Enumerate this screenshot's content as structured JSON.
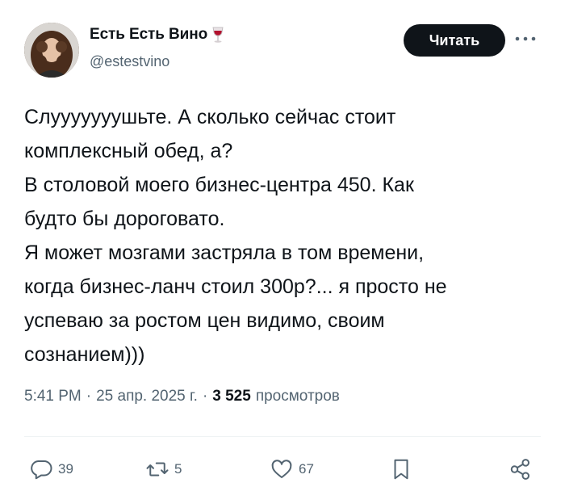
{
  "author": {
    "display_name": "Есть Есть Вино",
    "name_emoji": "wine-glass-icon",
    "handle": "@estestvino",
    "avatar": "avatar"
  },
  "follow_label": "Читать",
  "more_icon": "more-icon",
  "text": "Слууууууушьте. А сколько сейчас стоит\nкомплексный обед, а?\nВ столовой моего бизнес-центра 450. Как\nбудто бы дороговато.\nЯ может мозгами застряла в том времени,\nкогда бизнес-ланч стоил 300р?... я просто не\nуспеваю за ростом цен видимо, своим\nсознанием)))",
  "meta": {
    "time": "5:41 PM",
    "separator": "·",
    "date": "25 апр. 2025 г.",
    "views_count": "3 525",
    "views_label": "просмотров"
  },
  "actions": {
    "replies": "39",
    "reposts": "5",
    "likes": "67"
  },
  "colors": {
    "text": "#0f1419",
    "secondary": "#536471",
    "button_bg": "#0f1419",
    "button_text": "#ffffff",
    "divider": "#eff3f4"
  }
}
